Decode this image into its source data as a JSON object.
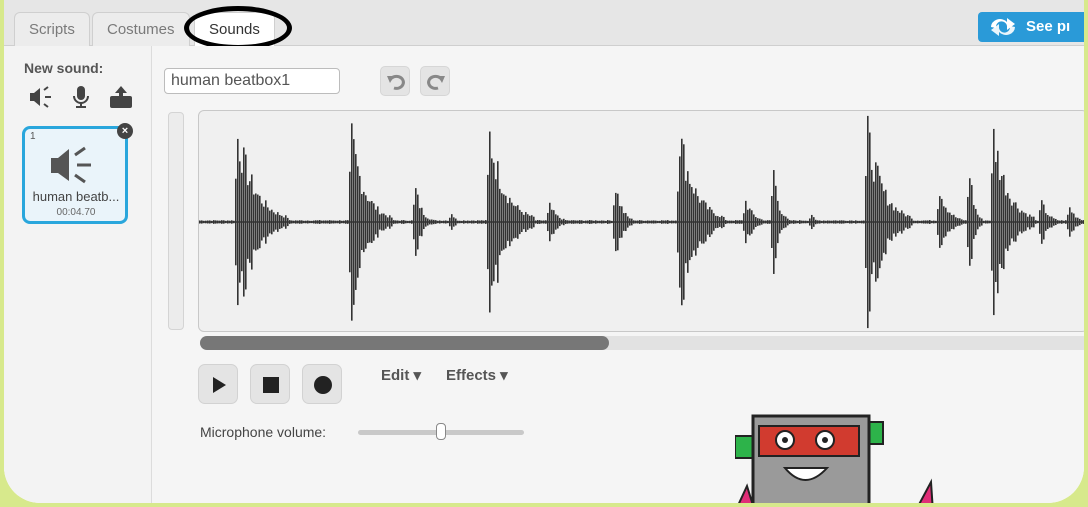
{
  "tabs": [
    {
      "label": "Scripts"
    },
    {
      "label": "Costumes"
    },
    {
      "label": "Sounds"
    }
  ],
  "see_project_label": "See pı",
  "new_sound": {
    "label": "New sound:",
    "icons": [
      "speaker-icon",
      "microphone-icon",
      "upload-icon"
    ]
  },
  "sound_card": {
    "index": "1",
    "name": "human beatb...",
    "duration": "00:04.70"
  },
  "editor": {
    "sound_name": "human beatbox1",
    "edit_label": "Edit ▾",
    "effects_label": "Effects ▾",
    "mic_label": "Microphone volume:",
    "mic_volume_fraction": 0.5,
    "scroll_fraction": 0.46
  },
  "colors": {
    "accent": "#29a6dc",
    "background_frame": "#d7e98c",
    "waveform": "#333333"
  }
}
